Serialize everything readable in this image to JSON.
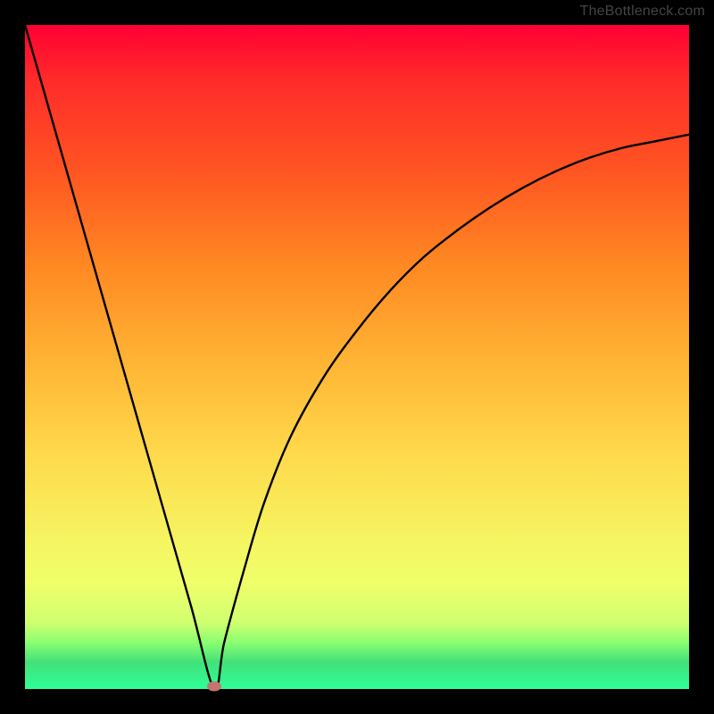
{
  "attribution": "TheBottleneck.com",
  "chart_data": {
    "type": "line",
    "title": "",
    "xlabel": "",
    "ylabel": "",
    "xlim": [
      0,
      1
    ],
    "ylim": [
      0,
      1
    ],
    "grid": false,
    "series": [
      {
        "name": "bottleneck-curve",
        "x": [
          0.0,
          0.05,
          0.1,
          0.15,
          0.2,
          0.25,
          0.285,
          0.3,
          0.33,
          0.36,
          0.4,
          0.45,
          0.5,
          0.55,
          0.6,
          0.65,
          0.7,
          0.75,
          0.8,
          0.85,
          0.9,
          0.95,
          1.0
        ],
        "y": [
          1.0,
          0.825,
          0.65,
          0.475,
          0.3,
          0.125,
          0.0,
          0.07,
          0.18,
          0.28,
          0.38,
          0.47,
          0.54,
          0.6,
          0.65,
          0.69,
          0.725,
          0.755,
          0.78,
          0.8,
          0.815,
          0.825,
          0.835
        ]
      }
    ],
    "minimum_marker": {
      "x": 0.285,
      "y": 0.0,
      "color": "#c5746e"
    },
    "gradient": {
      "top": "#ff0033",
      "mid": "#ffd84a",
      "bottom": "#2eff96"
    }
  }
}
